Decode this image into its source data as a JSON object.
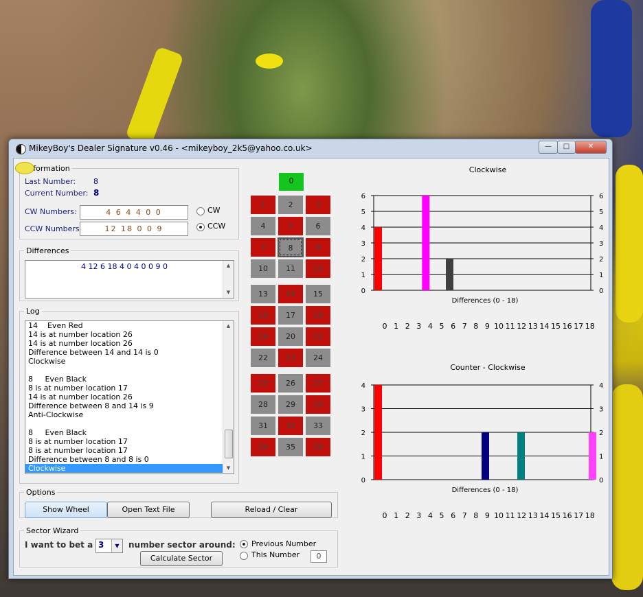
{
  "window": {
    "title": "MikeyBoy's Dealer Signature v0.46 - <mikeyboy_2k5@yahoo.co.uk>"
  },
  "info": {
    "legend": "Information",
    "last_label": "Last Number:",
    "last_value": "8",
    "current_label": "Current Number:",
    "current_value": "8",
    "cw_label": "CW Numbers:",
    "cw_value": "4 6 4 4 0 0",
    "ccw_label": "CCW Numbers:",
    "ccw_value": "12 18 0 0 9",
    "radio_cw": "CW",
    "radio_ccw": "CCW"
  },
  "differences": {
    "legend": "Differences",
    "text": "4 12 6 18 4 0 4 0 0 9 0"
  },
  "log": {
    "legend": "Log",
    "lines": [
      "14    Even Red",
      "14 is at number location 26",
      "14 is at number location 26",
      "Difference between 14 and 14 is 0",
      "Clockwise",
      "",
      "8     Even Black",
      "8 is at number location 17",
      "14 is at number location 26",
      "Difference between 8 and 14 is 9",
      "Anti-Clockwise",
      "",
      "8     Even Black",
      "8 is at number location 17",
      "8 is at number location 17",
      "Difference between 8 and 8 is 0",
      "Clockwise"
    ]
  },
  "options": {
    "legend": "Options",
    "show_wheel": "Show Wheel",
    "open_text": "Open Text File",
    "reload": "Reload / Clear"
  },
  "sector": {
    "legend": "Sector Wizard",
    "prefix": "I want to bet a",
    "count": "3",
    "suffix": "number sector around:",
    "calc": "Calculate Sector",
    "radio_prev": "Previous Number",
    "radio_this": "This Number",
    "this_value": "0"
  },
  "board": {
    "zero": "0",
    "rows": [
      [
        {
          "n": "1",
          "c": "red"
        },
        {
          "n": "2",
          "c": "gray"
        },
        {
          "n": "3",
          "c": "red"
        }
      ],
      [
        {
          "n": "4",
          "c": "gray"
        },
        {
          "n": "5",
          "c": "red"
        },
        {
          "n": "6",
          "c": "gray"
        }
      ],
      [
        {
          "n": "7",
          "c": "red"
        },
        {
          "n": "8",
          "c": "gray",
          "sel": true
        },
        {
          "n": "9",
          "c": "red"
        }
      ],
      [
        {
          "n": "10",
          "c": "gray"
        },
        {
          "n": "11",
          "c": "gray"
        },
        {
          "n": "12",
          "c": "red"
        }
      ],
      [
        {
          "n": "13",
          "c": "gray"
        },
        {
          "n": "14",
          "c": "red"
        },
        {
          "n": "15",
          "c": "gray"
        }
      ],
      [
        {
          "n": "16",
          "c": "red"
        },
        {
          "n": "17",
          "c": "gray"
        },
        {
          "n": "18",
          "c": "red"
        }
      ],
      [
        {
          "n": "19",
          "c": "red"
        },
        {
          "n": "20",
          "c": "gray"
        },
        {
          "n": "21",
          "c": "red"
        }
      ],
      [
        {
          "n": "22",
          "c": "gray"
        },
        {
          "n": "23",
          "c": "red"
        },
        {
          "n": "24",
          "c": "gray"
        }
      ],
      [
        {
          "n": "25",
          "c": "red"
        },
        {
          "n": "26",
          "c": "gray"
        },
        {
          "n": "27",
          "c": "red"
        }
      ],
      [
        {
          "n": "28",
          "c": "gray"
        },
        {
          "n": "29",
          "c": "gray"
        },
        {
          "n": "30",
          "c": "red"
        }
      ],
      [
        {
          "n": "31",
          "c": "gray"
        },
        {
          "n": "32",
          "c": "red"
        },
        {
          "n": "33",
          "c": "gray"
        }
      ],
      [
        {
          "n": "34",
          "c": "red"
        },
        {
          "n": "35",
          "c": "gray"
        },
        {
          "n": "36",
          "c": "red"
        }
      ]
    ]
  },
  "chart_data": [
    {
      "type": "bar",
      "title": "Clockwise",
      "xlabel": "Differences (0 - 18)",
      "categories": [
        "0",
        "1",
        "2",
        "3",
        "4",
        "5",
        "6",
        "7",
        "8",
        "9",
        "10",
        "11",
        "12",
        "13",
        "14",
        "15",
        "16",
        "17",
        "18"
      ],
      "values": [
        4,
        0,
        0,
        0,
        6,
        0,
        2,
        0,
        0,
        0,
        0,
        0,
        0,
        0,
        0,
        0,
        0,
        0,
        0
      ],
      "colors": [
        "#ff0000",
        "#ff0000",
        "#ff0000",
        "#ff0000",
        "#ff00ff",
        "#ff0000",
        "#404040",
        "#ff0000",
        "#ff0000",
        "#ff0000",
        "#ff0000",
        "#ff0000",
        "#ff0000",
        "#ff0000",
        "#ff0000",
        "#ff0000",
        "#ff0000",
        "#ff0000",
        "#ff0000"
      ],
      "ylim": [
        0,
        6
      ],
      "yticks": [
        "0",
        "1",
        "2",
        "3",
        "4",
        "5",
        "6"
      ],
      "grid": true
    },
    {
      "type": "bar",
      "title": "Counter - Clockwise",
      "xlabel": "Differences (0 - 18)",
      "categories": [
        "0",
        "1",
        "2",
        "3",
        "4",
        "5",
        "6",
        "7",
        "8",
        "9",
        "10",
        "11",
        "12",
        "13",
        "14",
        "15",
        "16",
        "17",
        "18"
      ],
      "values": [
        4,
        0,
        0,
        0,
        0,
        0,
        0,
        0,
        0,
        2,
        0,
        0,
        2,
        0,
        0,
        0,
        0,
        0,
        2
      ],
      "colors": [
        "#ff0000",
        "#ff0000",
        "#ff0000",
        "#ff0000",
        "#ff0000",
        "#ff0000",
        "#ff0000",
        "#ff0000",
        "#ff0000",
        "#000080",
        "#ff0000",
        "#ff0000",
        "#008080",
        "#ff0000",
        "#ff0000",
        "#ff0000",
        "#ff0000",
        "#ff0000",
        "#ff40ff"
      ],
      "ylim": [
        0,
        4
      ],
      "yticks": [
        "0",
        "1",
        "2",
        "3",
        "4"
      ],
      "grid": true
    }
  ]
}
